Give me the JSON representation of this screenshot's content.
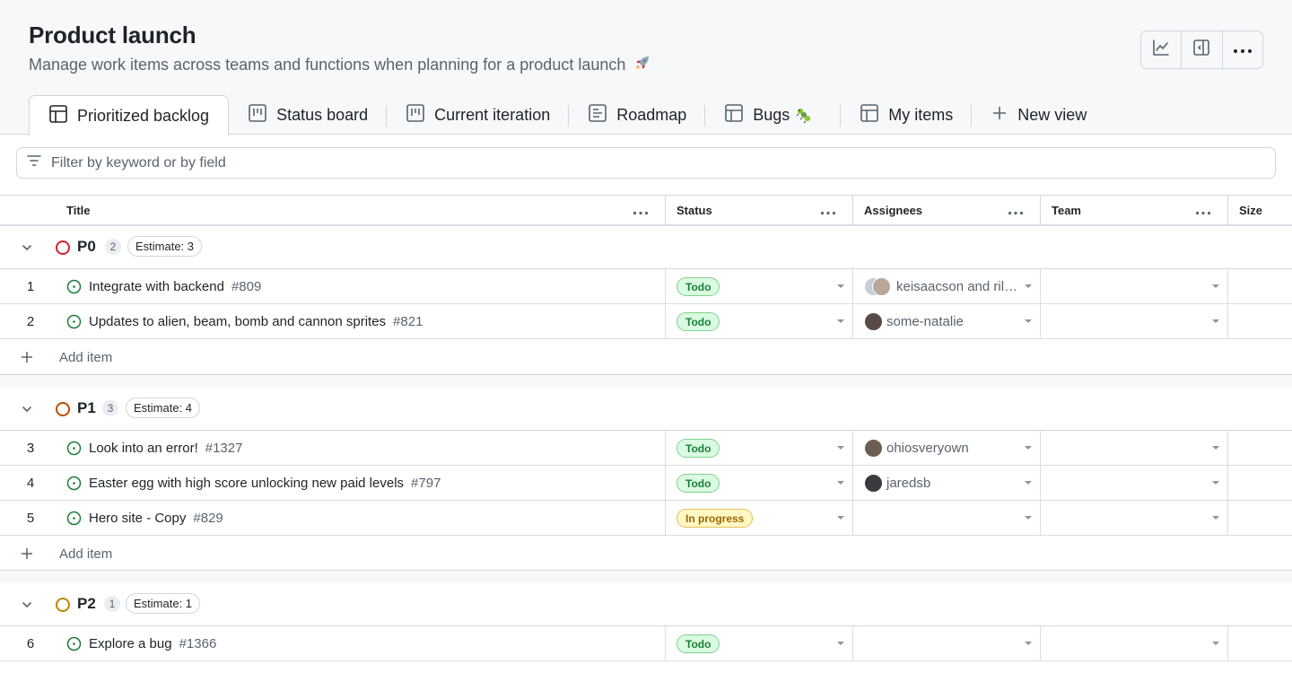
{
  "project": {
    "title": "Product launch",
    "description": "Manage work items across teams and functions when planning for a product launch"
  },
  "header_actions": [
    {
      "icon": "graph-icon"
    },
    {
      "icon": "sidebar-panel-icon"
    },
    {
      "icon": "kebab-horizontal-icon"
    }
  ],
  "tabs": [
    {
      "label": "Prioritized backlog",
      "icon": "table-icon",
      "active": true
    },
    {
      "label": "Status board",
      "icon": "project-board-icon"
    },
    {
      "label": "Current iteration",
      "icon": "project-board-icon"
    },
    {
      "label": "Roadmap",
      "icon": "roadmap-icon"
    },
    {
      "label": "Bugs",
      "icon": "table-icon",
      "emoji": "bug-emoji-icon"
    },
    {
      "label": "My items",
      "icon": "table-icon"
    },
    {
      "label": "New view",
      "icon": "plus-icon"
    }
  ],
  "filter": {
    "placeholder": "Filter by keyword or by field",
    "value": ""
  },
  "columns": {
    "title": "Title",
    "status": "Status",
    "assignees": "Assignees",
    "team": "Team",
    "size": "Size"
  },
  "groups": [
    {
      "name": "P0",
      "count": "2",
      "estimate": "Estimate: 3",
      "color": "#cf222e",
      "add_label": "Add item",
      "items": [
        {
          "num": "1",
          "title": "Integrate with backend",
          "issue": "#809",
          "status": "Todo",
          "assignees": "keisaacson and ril…"
        },
        {
          "num": "2",
          "title": "Updates to alien, beam, bomb and cannon sprites",
          "issue": "#821",
          "status": "Todo",
          "assignees": "some-natalie"
        }
      ]
    },
    {
      "name": "P1",
      "count": "3",
      "estimate": "Estimate: 4",
      "color": "#bc4c00",
      "add_label": "Add item",
      "items": [
        {
          "num": "3",
          "title": "Look into an error!",
          "issue": "#1327",
          "status": "Todo",
          "assignees": "ohiosveryown"
        },
        {
          "num": "4",
          "title": "Easter egg with high score unlocking new paid levels",
          "issue": "#797",
          "status": "Todo",
          "assignees": "jaredsb"
        },
        {
          "num": "5",
          "title": "Hero site - Copy",
          "issue": "#829",
          "status": "In progress",
          "assignees": ""
        }
      ]
    },
    {
      "name": "P2",
      "count": "1",
      "estimate": "Estimate: 1",
      "color": "#bf8700",
      "items": [
        {
          "num": "6",
          "title": "Explore a bug",
          "issue": "#1366",
          "status": "Todo",
          "assignees": ""
        }
      ]
    }
  ],
  "colors": {
    "todo": "#1a7f37",
    "in_progress": "#9a6700",
    "open_issue": "#1a7f37",
    "border": "#d0d7de"
  }
}
